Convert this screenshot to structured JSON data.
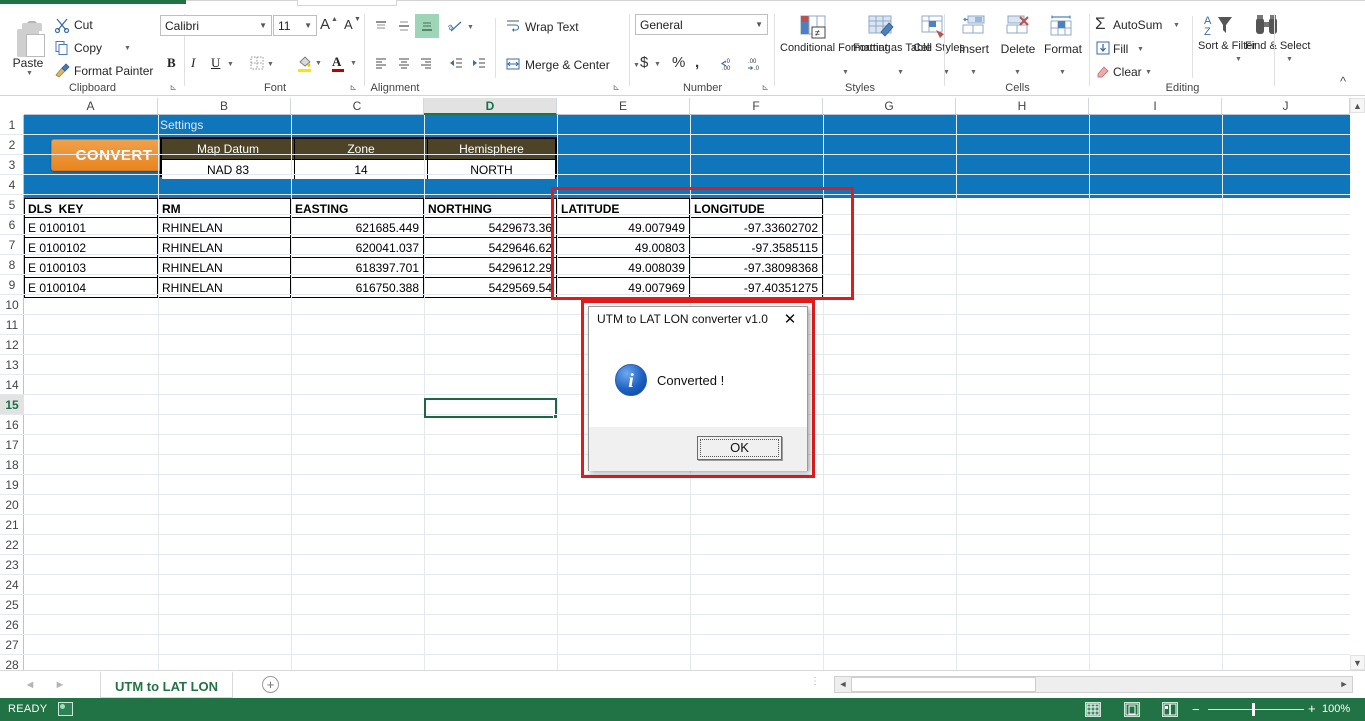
{
  "ribbon": {
    "clipboard": {
      "label": "Clipboard",
      "paste": "Paste",
      "cut": "Cut",
      "copy": "Copy",
      "format_painter": "Format Painter"
    },
    "font": {
      "label": "Font",
      "family": "Calibri",
      "size": "11",
      "bold": "B",
      "italic": "I",
      "underline": "U",
      "grow_font": "A",
      "shrink_font": "A"
    },
    "alignment": {
      "label": "Alignment",
      "wrap_text": "Wrap Text",
      "merge_center": "Merge & Center"
    },
    "number": {
      "label": "Number",
      "format": "General",
      "currency": "$",
      "percent": "%",
      "comma": ",",
      "increase_decimal": ".00",
      "decrease_decimal": ".00"
    },
    "styles": {
      "label": "Styles",
      "conditional_formatting": "Conditional Formatting",
      "format_as_table": "Format as Table",
      "cell_styles": "Cell Styles"
    },
    "cells": {
      "label": "Cells",
      "insert": "Insert",
      "delete": "Delete",
      "format": "Format"
    },
    "editing": {
      "label": "Editing",
      "autosum": "AutoSum",
      "fill": "Fill",
      "clear": "Clear",
      "sort_filter": "Sort & Filter",
      "find_select": "Find & Select"
    }
  },
  "grid": {
    "columns": [
      "A",
      "B",
      "C",
      "D",
      "E",
      "F",
      "G",
      "H",
      "I",
      "J"
    ],
    "active_column": "D",
    "rows": [
      "1",
      "2",
      "3",
      "4",
      "5",
      "6",
      "7",
      "8",
      "9",
      "10",
      "11",
      "12",
      "13",
      "14",
      "15",
      "16",
      "17",
      "18",
      "19",
      "20",
      "21",
      "22",
      "23",
      "24",
      "25",
      "26",
      "27",
      "28"
    ],
    "active_row": "15",
    "selected_cell": "D15"
  },
  "sheet": {
    "settings_label": "Settings",
    "convert_button": "CONVERT",
    "settings_table": {
      "headers": [
        "Map Datum",
        "Zone",
        "Hemisphere"
      ],
      "values": [
        "NAD 83",
        "14",
        "NORTH"
      ]
    },
    "data_headers": [
      "DLS_KEY",
      "RM",
      "EASTING",
      "NORTHING",
      "LATITUDE",
      "LONGITUDE"
    ],
    "data_rows": [
      [
        "E 0100101",
        "RHINELAN",
        "621685.449",
        "5429673.36",
        "49.007949",
        "-97.33602702"
      ],
      [
        "E 0100102",
        "RHINELAN",
        "620041.037",
        "5429646.62",
        "49.00803",
        "-97.3585115"
      ],
      [
        "E 0100103",
        "RHINELAN",
        "618397.701",
        "5429612.29",
        "49.008039",
        "-97.38098368"
      ],
      [
        "E 0100104",
        "RHINELAN",
        "616750.388",
        "5429569.54",
        "49.007969",
        "-97.40351275"
      ]
    ]
  },
  "dialog": {
    "title": "UTM to LAT LON converter v1.0",
    "close": "✕",
    "message": "Converted !",
    "ok_button": "OK",
    "icon": "i"
  },
  "sheet_tabs": {
    "tabs": [
      "UTM to LAT LON"
    ],
    "active": "UTM to LAT LON",
    "add_label": "+",
    "prev": "◄",
    "next": "►"
  },
  "status_bar": {
    "state": "READY",
    "zoom": "100%",
    "zoom_out": "−",
    "zoom_in": "+"
  },
  "colors": {
    "excel_green": "#217346",
    "header_blue": "#1076bc",
    "convert_orange": "#e8861f",
    "table_header_olive": "#4d4427",
    "highlight_red": "#e01b1b"
  }
}
